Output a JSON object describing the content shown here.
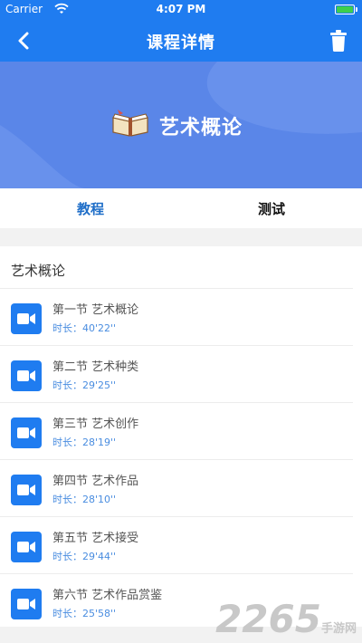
{
  "status_bar": {
    "carrier": "Carrier",
    "time": "4:07 PM"
  },
  "nav": {
    "title": "课程详情",
    "back_icon": "chevron-left-icon",
    "delete_icon": "trash-icon"
  },
  "banner": {
    "course_title": "艺术概论",
    "icon": "open-book-icon"
  },
  "tabs": [
    {
      "label": "教程",
      "active": true
    },
    {
      "label": "测试",
      "active": false
    }
  ],
  "section": {
    "title": "艺术概论"
  },
  "lessons": [
    {
      "name": "第一节 艺术概论",
      "duration_label": "时长：",
      "duration": "40'22''"
    },
    {
      "name": "第二节 艺术种类",
      "duration_label": "时长：",
      "duration": "29'25''"
    },
    {
      "name": "第三节 艺术创作",
      "duration_label": "时长：",
      "duration": "28'19''"
    },
    {
      "name": "第四节 艺术作品",
      "duration_label": "时长：",
      "duration": "28'10''"
    },
    {
      "name": "第五节 艺术接受",
      "duration_label": "时长：",
      "duration": "29'44''"
    },
    {
      "name": "第六节 艺术作品赏鉴",
      "duration_label": "时长：",
      "duration": "25'58''"
    }
  ],
  "watermark": {
    "number": "2265",
    "suffix": "手游网"
  },
  "colors": {
    "primary": "#1f7cf0",
    "banner": "#5a86e8",
    "active_tab": "#1f6ec8",
    "duration": "#4a8de0"
  }
}
